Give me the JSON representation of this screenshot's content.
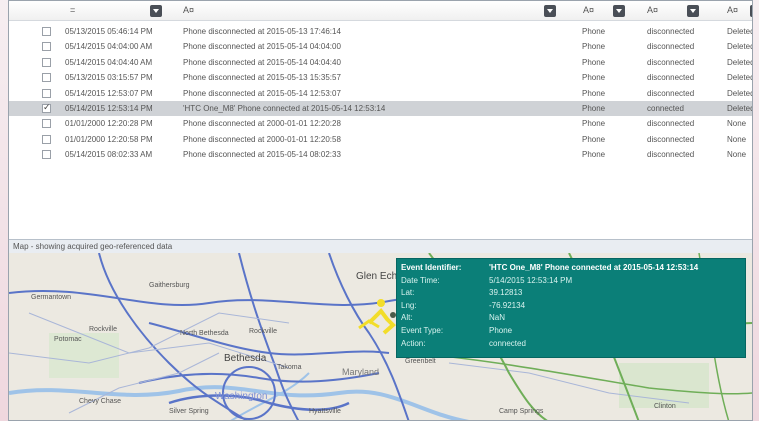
{
  "grid": {
    "filter_labels": [
      "=",
      "A¤",
      "A¤",
      "A¤",
      "A¤"
    ],
    "rows": [
      {
        "checked": false,
        "selected": false,
        "time": "05/13/2015 05:46:14 PM",
        "event": "Phone disconnected at 2015-05-13 17:46:14",
        "type": "Phone",
        "action": "disconnected",
        "status": "Deleted"
      },
      {
        "checked": false,
        "selected": false,
        "time": "05/14/2015 04:04:00 AM",
        "event": "Phone disconnected at 2015-05-14 04:04:00",
        "type": "Phone",
        "action": "disconnected",
        "status": "Deleted"
      },
      {
        "checked": false,
        "selected": false,
        "time": "05/14/2015 04:04:40 AM",
        "event": "Phone disconnected at 2015-05-14 04:04:40",
        "type": "Phone",
        "action": "disconnected",
        "status": "Deleted"
      },
      {
        "checked": false,
        "selected": false,
        "time": "05/13/2015 03:15:57 PM",
        "event": "Phone disconnected at 2015-05-13 15:35:57",
        "type": "Phone",
        "action": "disconnected",
        "status": "Deleted"
      },
      {
        "checked": false,
        "selected": false,
        "time": "05/14/2015 12:53:07 PM",
        "event": "Phone disconnected at 2015-05-14 12:53:07",
        "type": "Phone",
        "action": "disconnected",
        "status": "Deleted"
      },
      {
        "checked": true,
        "selected": true,
        "time": "05/14/2015 12:53:14 PM",
        "event": "'HTC One_M8' Phone connected at 2015-05-14 12:53:14",
        "type": "Phone",
        "action": "connected",
        "status": "Deleted"
      },
      {
        "checked": false,
        "selected": false,
        "time": "01/01/2000 12:20:28 PM",
        "event": "Phone disconnected at 2000-01-01 12:20:28",
        "type": "Phone",
        "action": "disconnected",
        "status": "None"
      },
      {
        "checked": false,
        "selected": false,
        "time": "01/01/2000 12:20:58 PM",
        "event": "Phone disconnected at 2000-01-01 12:20:58",
        "type": "Phone",
        "action": "disconnected",
        "status": "None"
      },
      {
        "checked": false,
        "selected": false,
        "time": "05/14/2015 08:02:33 AM",
        "event": "Phone disconnected at 2015-05-14 08:02:33",
        "type": "Phone",
        "action": "disconnected",
        "status": "None"
      }
    ]
  },
  "map": {
    "header": "Map - showing acquired geo-referenced data",
    "places": [
      "Glen Echo",
      "Bethesda",
      "North Bethesda",
      "Gaithersburg",
      "Rockville",
      "Potomac",
      "Germantown",
      "Takoma",
      "Rockville",
      "Maryland",
      "Greenbelt",
      "Chevy Chase",
      "Washington",
      "Clinton",
      "Camp Springs",
      "Hyattsville",
      "Silver Spring"
    ],
    "colors": {
      "water": "#9fc3e8",
      "major_road": "#5a74c8",
      "green_road": "#6fae58",
      "marker": "#f2dd2a"
    }
  },
  "popup": {
    "rows": [
      {
        "label": "Event Identifier:",
        "value": "'HTC One_M8' Phone connected at 2015-05-14 12:53:14",
        "bold": true
      },
      {
        "label": "Date Time:",
        "value": "5/14/2015 12:53:14 PM",
        "bold": false
      },
      {
        "label": "Lat:",
        "value": "39.12813",
        "bold": false
      },
      {
        "label": "Lng:",
        "value": "-76.92134",
        "bold": false
      },
      {
        "label": "Alt:",
        "value": "NaN",
        "bold": false
      },
      {
        "label": "Event Type:",
        "value": "Phone",
        "bold": false
      },
      {
        "label": "Action:",
        "value": "connected",
        "bold": false
      }
    ]
  }
}
